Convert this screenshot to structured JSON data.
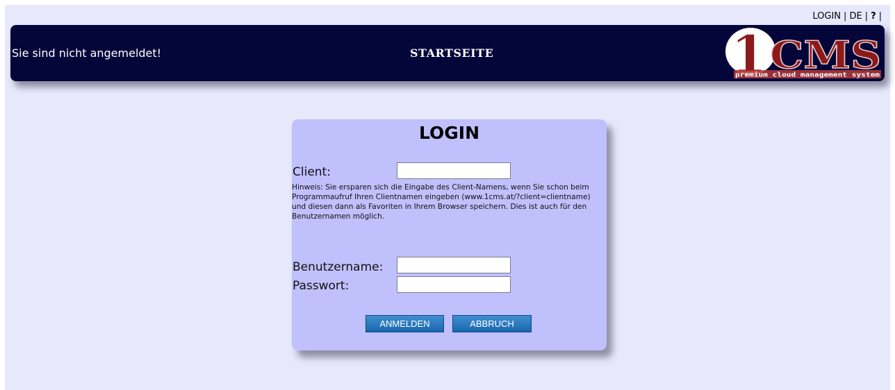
{
  "toplinks": {
    "login": "LOGIN",
    "sep": "|",
    "language": "DE",
    "help": "?"
  },
  "header": {
    "status": "Sie sind nicht angemeldet!",
    "title": "STARTSEITE",
    "logo": {
      "main": "1CMS",
      "tagline": "premium cloud management system"
    }
  },
  "login": {
    "title": "LOGIN",
    "client_label": "Client:",
    "client_value": "",
    "hint": "Hinweis: Sie ersparen sich die Eingabe des Client-Namens, wenn Sie schon beim Programmaufruf Ihren Clientnamen eingeben (www.1cms.at/?client=clientname) und diesen dann als Favoriten in Ihrem Browser speichern. Dies ist auch für den Benutzernamen möglich.",
    "username_label": "Benutzername:",
    "username_value": "",
    "password_label": "Passwort:",
    "password_value": "",
    "submit_label": "ANMELDEN",
    "cancel_label": "ABBRUCH"
  },
  "colors": {
    "page_bg": "#e8e8fc",
    "header_bg": "#04063a",
    "login_bg": "#c0c0fc",
    "logo_red": "#8c1a1a",
    "button": "#2a78c0"
  }
}
